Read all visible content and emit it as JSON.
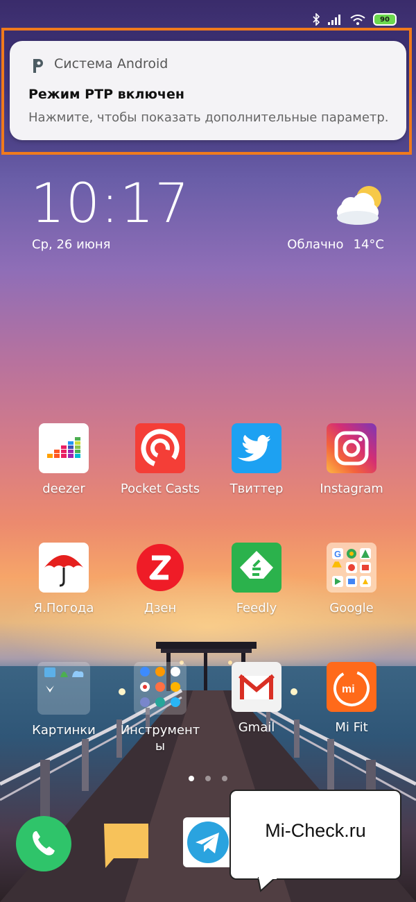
{
  "status_bar": {
    "battery_level": "90",
    "icons": [
      "bluetooth-icon",
      "signal-icon",
      "wifi-icon",
      "battery-icon"
    ]
  },
  "notification": {
    "app_name": "Система Android",
    "title": "Режим PTP включен",
    "text": "Нажмите, чтобы показать дополнительные параметр..",
    "highlight_color": "#f07a1c"
  },
  "clock": {
    "time": "10:17",
    "date": "Ср, 26 июня"
  },
  "weather": {
    "condition": "Облачно",
    "temperature": "14°C",
    "icon": "partly-cloudy-icon"
  },
  "apps": {
    "deezer": "deezer",
    "pocketcasts": "Pocket Casts",
    "twitter": "Твиттер",
    "instagram": "Instagram",
    "yapogoda": "Я.Погода",
    "zen": "Дзен",
    "feedly": "Feedly",
    "google": "Google",
    "kartinki": "Картинки",
    "instrumenty_line1": "Инструмент",
    "instrumenty_line2": "ы",
    "gmail": "Gmail",
    "mifit": "Mi Fit"
  },
  "pager": {
    "pages": 3,
    "active": 1
  },
  "dock": [
    "phone-icon",
    "messages-icon",
    "telegram-icon"
  ],
  "watermark": {
    "text": "Mi-Check.ru"
  }
}
